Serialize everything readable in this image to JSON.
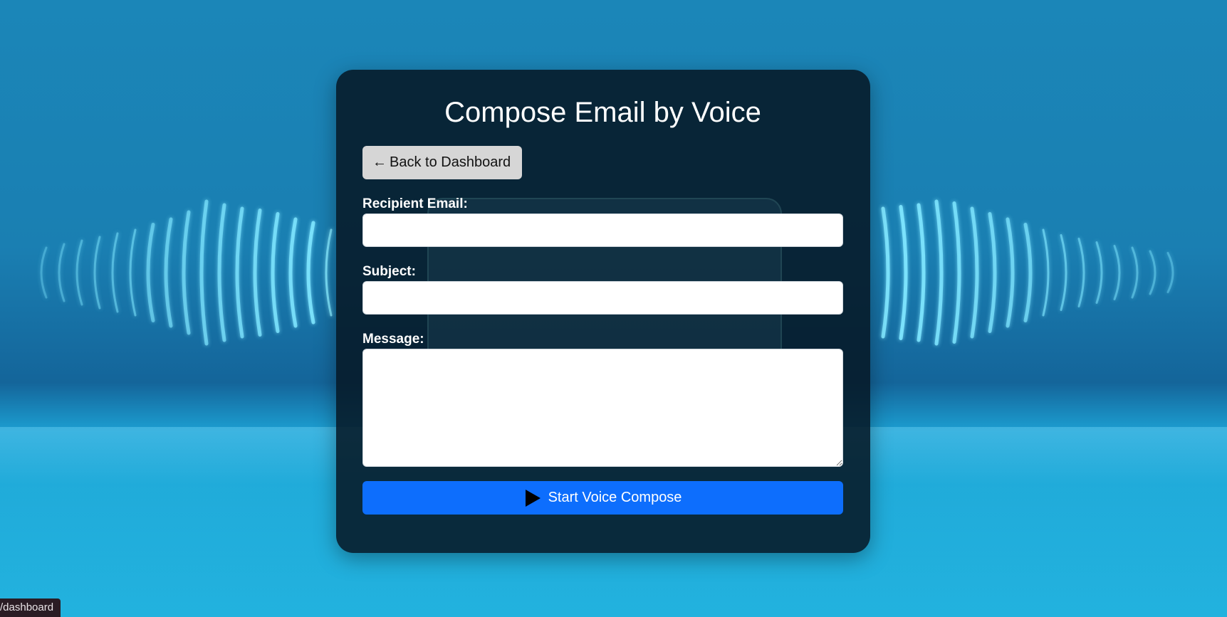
{
  "page": {
    "title": "Compose Email by Voice"
  },
  "nav": {
    "back_arrow": "←",
    "back_label": "Back to Dashboard"
  },
  "form": {
    "recipient_label": "Recipient Email:",
    "recipient_value": "",
    "subject_label": "Subject:",
    "subject_value": "",
    "message_label": "Message:",
    "message_value": ""
  },
  "actions": {
    "start_label": "Start Voice Compose",
    "start_icon": "play-icon"
  },
  "status_bar": {
    "url": "/dashboard"
  },
  "colors": {
    "card_bg": "#061826",
    "primary": "#0d6efd",
    "back_button_bg": "#d6d6d6"
  }
}
